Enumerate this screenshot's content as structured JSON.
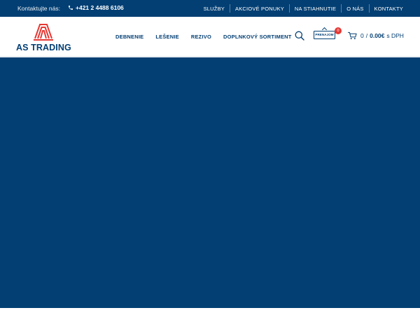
{
  "topbar": {
    "contact_label": "Kontaktujte nás:",
    "phone": "+421 2 4488 6106",
    "links": [
      "SLUŽBY",
      "AKCIOVÉ PONUKY",
      "NA STIAHNUTIE",
      "O NÁS",
      "KONTAKTY"
    ]
  },
  "logo": {
    "text": "AS TRADING"
  },
  "nav": {
    "items": [
      "DEBNENIE",
      "LEŠENIE",
      "REZIVO",
      "DOPLNKOVÝ SORTIMENT"
    ]
  },
  "rent": {
    "label": "PRENAJOM",
    "count": "0"
  },
  "cart": {
    "count": "0",
    "separator": "/",
    "total": "0.00€",
    "vat": "s DPH"
  },
  "icons": {
    "phone": "phone-icon",
    "logo": "logo-mark-icon",
    "search": "search-icon",
    "rent": "rent-sign-icon",
    "cart": "cart-icon"
  },
  "colors": {
    "brand_navy": "#033f73",
    "logo_red": "#e53935",
    "badge_red": "#e53935",
    "background": "#ffffff"
  }
}
